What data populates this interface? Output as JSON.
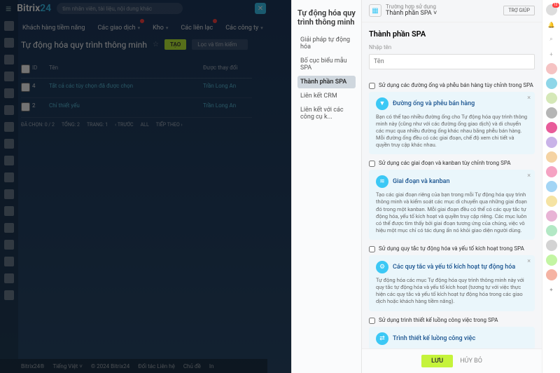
{
  "logo": {
    "part1": "Bitrix",
    "part2": "24"
  },
  "search_placeholder": "tìm nhân viên, tài liệu, nội dung khác",
  "tabs": [
    {
      "label": "Khách hàng tiềm năng"
    },
    {
      "label": "Các giao dịch"
    },
    {
      "label": "Kho"
    },
    {
      "label": "Các liên lạc"
    },
    {
      "label": "Các công ty"
    }
  ],
  "page_title": "Tự động hóa quy trình thông minh",
  "create_btn": "TẠO",
  "filter_placeholder": "Lọc và tìm kiếm",
  "table": {
    "headers": {
      "id": "ID",
      "name": "Tên",
      "modified_by": "Được thay đổi"
    },
    "rows": [
      {
        "id": "4",
        "name": "Tắt cả các tùy chọn đã được chọn",
        "by": "Trần Long An"
      },
      {
        "id": "2",
        "name": "Chỉ thiết yếu",
        "by": "Trần Long An"
      }
    ],
    "footer": {
      "selected": "ĐÃ CHỌN: 0 / 2",
      "total": "TỔNG: 2",
      "page": "TRANG: 1",
      "prev": "‹ TRƯỚC",
      "all": "ALL",
      "next": "TIẾP THEO ›"
    }
  },
  "bottom": {
    "brand": "Bitrix24®",
    "lang": "Tiếng Việt ˅",
    "copyright": "© 2024 Bitrix24",
    "partners": "Đối tác Liên hệ",
    "themes": "Chủ đề",
    "print": "In"
  },
  "side_nav": {
    "title": "Tự động hóa quy trình thông minh",
    "items": [
      "Giải pháp tự động hóa",
      "Bố cục biểu mẫu SPA",
      "Thành phần SPA",
      "Liên kết CRM",
      "Liên kết với các công cụ k..."
    ],
    "active_index": 2
  },
  "panel": {
    "header_small": "Trường hợp sử dụng",
    "header_main": "Thành phần SPA ˅",
    "help": "TRỢ GIÚP",
    "title": "Thành phần SPA",
    "name_label": "Nhập tên",
    "name_placeholder": "Tên",
    "sections": [
      {
        "checkbox": "Sử dụng các đường ống và phễu bán hàng tùy chỉnh trong SPA",
        "card_title": "Đường ống và phễu bán hàng",
        "card_desc": "Bạn có thể tạo nhiều đường ống cho Tự động hóa quy trình thông minh này (cũng như với các đường ống giao dịch) và di chuyển các mục qua nhiều đường ống khác nhau bằng phễu bán hàng. Mỗi đường ống đều có các giai đoạn, chế độ xem chi tiết và quyền truy cập khác nhau."
      },
      {
        "checkbox": "Sử dụng các giai đoạn và kanban tùy chỉnh trong SPA",
        "card_title": "Giai đoạn và kanban",
        "card_desc": "Tạo các giai đoạn riêng của bạn trong mỗi Tự động hóa quy trình thông minh và kiểm soát các mục di chuyển qua những giai đoạn đó trong một kanban. Mỗi giai đoạn đều có thể có các quy tắc tự động hóa, yếu tố kích hoạt và quyền truy cập riêng. Các mục luôn có thể được tìm thấy bởi giai đoạn tương ứng của chúng, việc vô hiệu một mục chỉ có tác dụng ẩn nó khỏi giao diện người dùng."
      },
      {
        "checkbox": "Sử dụng quy tắc tự động hóa và yếu tố kích hoạt trong SPA",
        "card_title": "Các quy tắc và yếu tố kích hoạt tự động hóa",
        "card_desc": "Tự động hóa các mục Tự động hóa quy trình thông minh này với quy tắc tự động hóa và yếu tố kích hoạt (tương tự với việc thực hiện các quy tắc và yếu tố kích hoạt tự động hóa trong các giao dịch hoặc khách hàng tiềm năng)."
      },
      {
        "checkbox": "Sử dụng trình thiết kế luồng công việc trong SPA",
        "card_title": "Trình thiết kế luồng công việc",
        "card_desc": ""
      }
    ],
    "save": "LƯU",
    "cancel": "HỦY BỎ"
  },
  "right_rail_badge": "12"
}
